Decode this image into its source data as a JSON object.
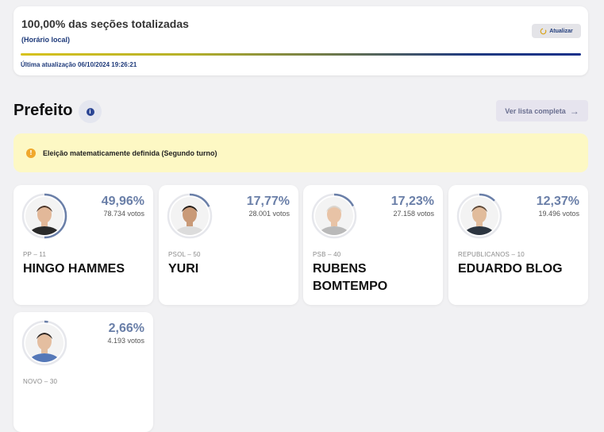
{
  "status": {
    "title": "100,00% das seções totalizadas",
    "subtitle": "(Horário local)",
    "refresh_label": "Atualizar",
    "updated": "Última atualização 06/10/2024 19:26:21",
    "progress": 1.0
  },
  "section": {
    "title": "Prefeito",
    "list_button": "Ver lista completa"
  },
  "alert": {
    "text": "Eleição matematicamente definida (Segundo turno)"
  },
  "candidates": [
    {
      "pct": "49,96%",
      "votes": "78.734 votos",
      "party": "PP – 11",
      "name": "HINGO HAMMES",
      "share": 0.4996
    },
    {
      "pct": "17,77%",
      "votes": "28.001 votos",
      "party": "PSOL – 50",
      "name": "YURI",
      "share": 0.1777
    },
    {
      "pct": "17,23%",
      "votes": "27.158 votos",
      "party": "PSB – 40",
      "name": "RUBENS BOMTEMPO",
      "share": 0.1723
    },
    {
      "pct": "12,37%",
      "votes": "19.496 votos",
      "party": "REPUBLICANOS – 10",
      "name": "EDUARDO BLOG",
      "share": 0.1237
    },
    {
      "pct": "2,66%",
      "votes": "4.193 votos",
      "party": "NOVO – 30",
      "name": "",
      "share": 0.0266
    }
  ],
  "colors": {
    "accent": "#1e3a7a",
    "percent": "#6a7fa8",
    "alert_bg": "#fdf8c4",
    "warning": "#f0a82c"
  },
  "icons": {
    "refresh": "refresh-icon",
    "info": "info-icon",
    "arrow": "arrow-right-icon",
    "warning": "warning-icon"
  }
}
